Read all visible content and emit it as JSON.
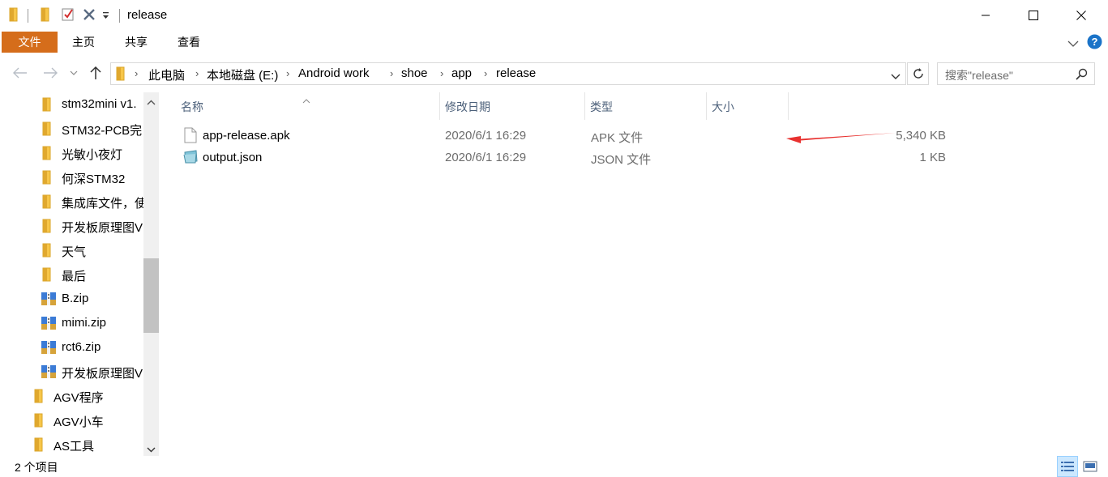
{
  "window": {
    "title": "release"
  },
  "ribbon": {
    "tabs": [
      {
        "label": "文件",
        "active": true
      },
      {
        "label": "主页"
      },
      {
        "label": "共享"
      },
      {
        "label": "查看"
      }
    ]
  },
  "address": {
    "crumbs": [
      "此电脑",
      "本地磁盘 (E:)",
      "Android work",
      "shoe",
      "app",
      "release"
    ]
  },
  "search": {
    "placeholder": "搜索\"release\""
  },
  "nav": {
    "items": [
      {
        "label": "stm32mini v1.",
        "icon": "folder-icon"
      },
      {
        "label": "STM32-PCB完",
        "icon": "folder-icon"
      },
      {
        "label": "光敏小夜灯",
        "icon": "folder-icon"
      },
      {
        "label": "何深STM32",
        "icon": "folder-icon"
      },
      {
        "label": "集成库文件，使",
        "icon": "folder-icon"
      },
      {
        "label": "开发板原理图V",
        "icon": "folder-icon"
      },
      {
        "label": "天气",
        "icon": "folder-icon"
      },
      {
        "label": "最后",
        "icon": "folder-icon"
      },
      {
        "label": "B.zip",
        "icon": "zip-archive-icon"
      },
      {
        "label": "mimi.zip",
        "icon": "zip-archive-icon"
      },
      {
        "label": "rct6.zip",
        "icon": "zip-archive-icon"
      },
      {
        "label": "开发板原理图V",
        "icon": "zip-archive-icon"
      },
      {
        "label": "AGV程序",
        "icon": "folder-icon"
      },
      {
        "label": "AGV小车",
        "icon": "folder-icon"
      },
      {
        "label": "AS工具",
        "icon": "folder-icon"
      }
    ]
  },
  "columns": {
    "name": "名称",
    "modified": "修改日期",
    "type": "类型",
    "size": "大小"
  },
  "files": [
    {
      "name": "app-release.apk",
      "modified": "2020/6/1 16:29",
      "type": "APK 文件",
      "size": "5,340 KB",
      "icon": "document-icon"
    },
    {
      "name": "output.json",
      "modified": "2020/6/1 16:29",
      "type": "JSON 文件",
      "size": "1 KB",
      "icon": "json-file-icon"
    }
  ],
  "status": {
    "count": "2 个项目"
  },
  "colors": {
    "file_tab": "#d56d1b",
    "annotation_arrow": "#e8312f",
    "header_text": "#4c607a",
    "folder": "#f7c649"
  }
}
